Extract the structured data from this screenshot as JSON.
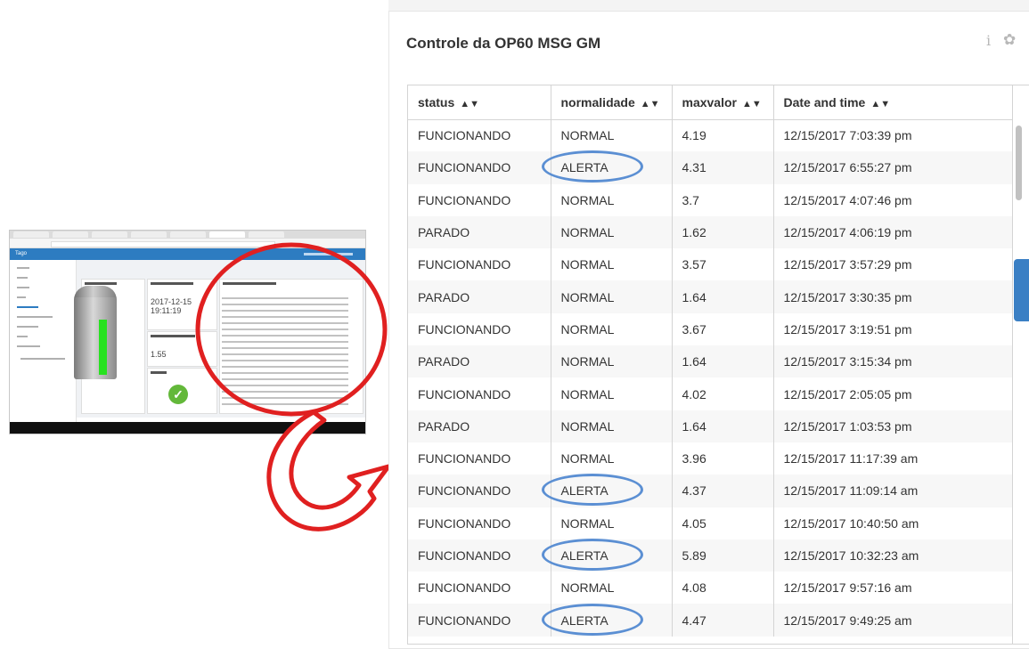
{
  "panel": {
    "title": "Controle da OP60 MSG GM",
    "columns": [
      "status",
      "normalidade",
      "maxvalor",
      "Date and time"
    ],
    "rows": [
      {
        "status": "FUNCIONANDO",
        "normalidade": "NORMAL",
        "maxvalor": "4.19",
        "datetime": "12/15/2017 7:03:39 pm",
        "highlight": false
      },
      {
        "status": "FUNCIONANDO",
        "normalidade": "ALERTA",
        "maxvalor": "4.31",
        "datetime": "12/15/2017 6:55:27 pm",
        "highlight": true
      },
      {
        "status": "FUNCIONANDO",
        "normalidade": "NORMAL",
        "maxvalor": "3.7",
        "datetime": "12/15/2017 4:07:46 pm",
        "highlight": false
      },
      {
        "status": "PARADO",
        "normalidade": "NORMAL",
        "maxvalor": "1.62",
        "datetime": "12/15/2017 4:06:19 pm",
        "highlight": false
      },
      {
        "status": "FUNCIONANDO",
        "normalidade": "NORMAL",
        "maxvalor": "3.57",
        "datetime": "12/15/2017 3:57:29 pm",
        "highlight": false
      },
      {
        "status": "PARADO",
        "normalidade": "NORMAL",
        "maxvalor": "1.64",
        "datetime": "12/15/2017 3:30:35 pm",
        "highlight": false
      },
      {
        "status": "FUNCIONANDO",
        "normalidade": "NORMAL",
        "maxvalor": "3.67",
        "datetime": "12/15/2017 3:19:51 pm",
        "highlight": false
      },
      {
        "status": "PARADO",
        "normalidade": "NORMAL",
        "maxvalor": "1.64",
        "datetime": "12/15/2017 3:15:34 pm",
        "highlight": false
      },
      {
        "status": "FUNCIONANDO",
        "normalidade": "NORMAL",
        "maxvalor": "4.02",
        "datetime": "12/15/2017 2:05:05 pm",
        "highlight": false
      },
      {
        "status": "PARADO",
        "normalidade": "NORMAL",
        "maxvalor": "1.64",
        "datetime": "12/15/2017 1:03:53 pm",
        "highlight": false
      },
      {
        "status": "FUNCIONANDO",
        "normalidade": "NORMAL",
        "maxvalor": "3.96",
        "datetime": "12/15/2017 11:17:39 am",
        "highlight": false
      },
      {
        "status": "FUNCIONANDO",
        "normalidade": "ALERTA",
        "maxvalor": "4.37",
        "datetime": "12/15/2017 11:09:14 am",
        "highlight": true
      },
      {
        "status": "FUNCIONANDO",
        "normalidade": "NORMAL",
        "maxvalor": "4.05",
        "datetime": "12/15/2017 10:40:50 am",
        "highlight": false
      },
      {
        "status": "FUNCIONANDO",
        "normalidade": "ALERTA",
        "maxvalor": "5.89",
        "datetime": "12/15/2017 10:32:23 am",
        "highlight": true
      },
      {
        "status": "FUNCIONANDO",
        "normalidade": "NORMAL",
        "maxvalor": "4.08",
        "datetime": "12/15/2017 9:57:16 am",
        "highlight": false
      },
      {
        "status": "FUNCIONANDO",
        "normalidade": "ALERTA",
        "maxvalor": "4.47",
        "datetime": "12/15/2017 9:49:25 am",
        "highlight": true
      }
    ]
  },
  "thumbnail": {
    "app_name": "Tago",
    "date_value": "2017-12-15 19:11:19",
    "current_value": "1.55"
  },
  "icons": {
    "info": "info-icon",
    "settings": "gear-icon",
    "sort": "sort-icon",
    "check": "check-icon"
  },
  "colors": {
    "highlight_oval": "#5b8fd3",
    "callout": "#e02020",
    "accent": "#2d7cc1",
    "silo_level": "#27e21f",
    "ok_badge": "#63b83a"
  }
}
